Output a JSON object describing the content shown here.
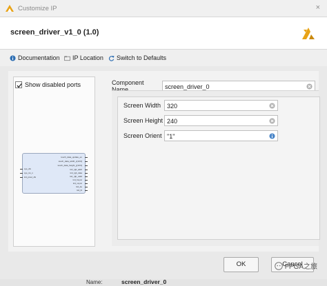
{
  "window": {
    "title": "Customize IP",
    "close_glyph": "×"
  },
  "header": {
    "ip_name": "screen_driver_v1_0 (1.0)"
  },
  "toolbar": {
    "documentation": "Documentation",
    "ip_location": "IP Location",
    "switch_defaults": "Switch to Defaults"
  },
  "left_panel": {
    "show_disabled_ports_label": "Show disabled ports",
    "show_disabled_ports_checked": true,
    "symbol": {
      "left_pins": [
        "sys_clk",
        "sys_rst_n",
        "lcd_pixel_clk"
      ],
      "right_pins": [
        "touch_data_update_en",
        "touch_data_width_x[10:0]",
        "touch_data_height_y[10:0]",
        "lcd_rgb_addr",
        "lcd_rgb_data",
        "lcd_rgb_valid",
        "lcd_hsync",
        "lcd_vsync",
        "lcd_de",
        "lcd_bl"
      ]
    }
  },
  "component": {
    "label": "Component Name",
    "value": "screen_driver_0"
  },
  "params": [
    {
      "label": "Screen Width",
      "value": "320",
      "icon": "clear-icon"
    },
    {
      "label": "Screen Height",
      "value": "240",
      "icon": "clear-icon"
    },
    {
      "label": "Screen Orient",
      "value": "\"1\"",
      "icon": "info-icon"
    }
  ],
  "buttons": {
    "ok": "OK",
    "cancel": "Cancel"
  },
  "footer": {
    "name_label": "Name:",
    "name_value": "screen_driver_0"
  },
  "watermark": {
    "text": "FPGA之旅"
  },
  "colors": {
    "accent": "#2f6fb3",
    "brand": "#e8a317"
  }
}
